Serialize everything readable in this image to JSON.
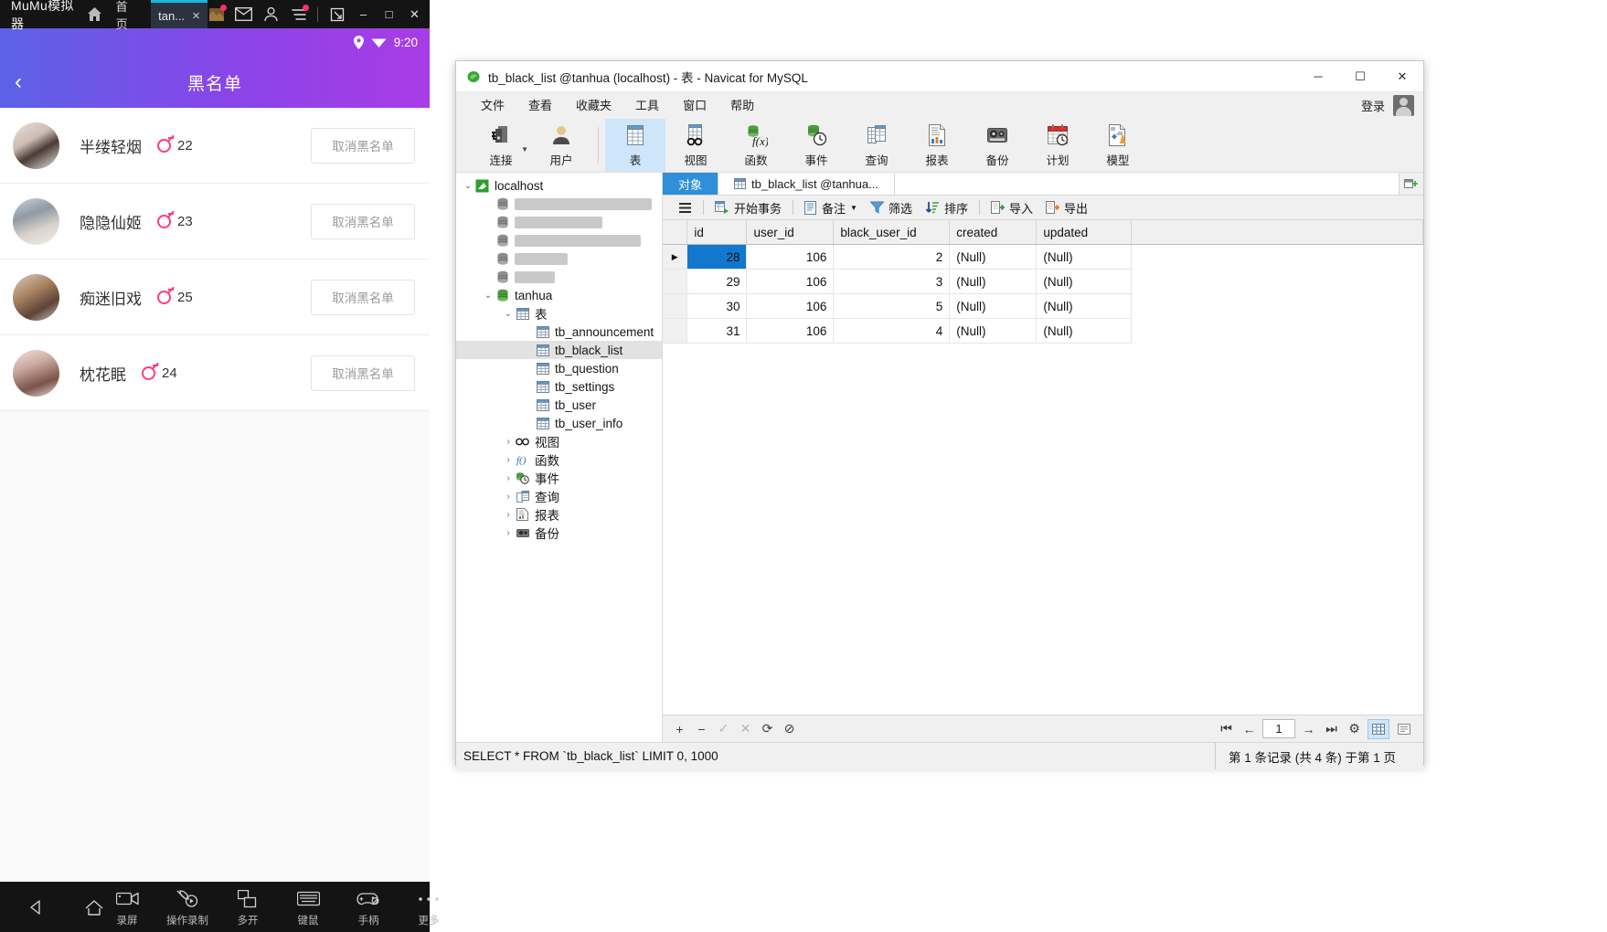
{
  "emulator": {
    "brand": "MuMu模拟器",
    "home_tab": "首页",
    "tab_label": "tan...",
    "tab_close": "×",
    "icons": {
      "home": "home-icon",
      "game": "game-thumb-icon",
      "mail": "mail-icon",
      "user": "user-icon",
      "menu": "menu-icon",
      "fullscreen": "fullscreen-icon",
      "minimize": "minimize-icon",
      "restore": "restore-icon",
      "close": "close-icon"
    },
    "window_minimize": "–",
    "window_restore": "□",
    "window_close": "✕",
    "status": {
      "location_icon": "location-pin-icon",
      "wifi_icon": "wifi-icon",
      "time": "9:20"
    },
    "app": {
      "back_icon": "back-chevron-icon",
      "title": "黑名单"
    },
    "list": [
      {
        "name": "半缕轻烟",
        "age": "22",
        "gender_icon": "male-gender-icon",
        "action": "取消黑名单"
      },
      {
        "name": "隐隐仙姬",
        "age": "23",
        "gender_icon": "male-gender-icon",
        "action": "取消黑名单"
      },
      {
        "name": "痴迷旧戏",
        "age": "25",
        "gender_icon": "male-gender-icon",
        "action": "取消黑名单"
      },
      {
        "name": "枕花眠",
        "age": "24",
        "gender_icon": "male-gender-icon",
        "action": "取消黑名单"
      }
    ],
    "navbar": {
      "back_icon": "triangle-back-icon",
      "home_icon": "home-outline-icon",
      "tools": [
        {
          "label": "录屏",
          "icon": "screen-record-icon"
        },
        {
          "label": "操作录制",
          "icon": "macro-record-icon"
        },
        {
          "label": "多开",
          "icon": "multi-instance-icon"
        },
        {
          "label": "键鼠",
          "icon": "keyboard-icon"
        },
        {
          "label": "手柄",
          "icon": "gamepad-icon"
        },
        {
          "label": "更多",
          "icon": "more-dots-icon"
        }
      ]
    }
  },
  "navicat": {
    "title": "tb_black_list @tanhua (localhost) - 表 - Navicat for MySQL",
    "title_icon": "navicat-logo-icon",
    "window_minimize": "─",
    "window_maximize": "☐",
    "window_close": "✕",
    "menu": [
      "文件",
      "查看",
      "收藏夹",
      "工具",
      "窗口",
      "帮助"
    ],
    "login_label": "登录",
    "toolbar": [
      {
        "label": "连接",
        "icon": "connection-icon",
        "has_caret": true,
        "selected": false
      },
      {
        "label": "用户",
        "icon": "user-icon",
        "has_caret": false,
        "selected": false
      },
      {
        "label": "表",
        "icon": "table-icon",
        "has_caret": false,
        "selected": true
      },
      {
        "label": "视图",
        "icon": "view-icon",
        "has_caret": false,
        "selected": false
      },
      {
        "label": "函数",
        "icon": "function-icon",
        "has_caret": false,
        "selected": false
      },
      {
        "label": "事件",
        "icon": "event-icon",
        "has_caret": false,
        "selected": false
      },
      {
        "label": "查询",
        "icon": "query-icon",
        "has_caret": false,
        "selected": false
      },
      {
        "label": "报表",
        "icon": "report-icon",
        "has_caret": false,
        "selected": false
      },
      {
        "label": "备份",
        "icon": "backup-icon",
        "has_caret": false,
        "selected": false
      },
      {
        "label": "计划",
        "icon": "schedule-icon",
        "has_caret": false,
        "selected": false
      },
      {
        "label": "模型",
        "icon": "model-icon",
        "has_caret": false,
        "selected": false
      }
    ],
    "tree": [
      {
        "label": "localhost",
        "indent": 0,
        "twisty": "⌄",
        "icon": "server-icon",
        "selected": false,
        "redacted": false
      },
      {
        "label": "",
        "indent": 1,
        "twisty": "",
        "icon": "database-icon",
        "selected": false,
        "redacted": true,
        "redact_w": 150
      },
      {
        "label": "",
        "indent": 1,
        "twisty": "",
        "icon": "database-icon",
        "selected": false,
        "redacted": true,
        "redact_w": 96
      },
      {
        "label": "",
        "indent": 1,
        "twisty": "",
        "icon": "database-icon",
        "selected": false,
        "redacted": true,
        "redact_w": 138
      },
      {
        "label": "",
        "indent": 1,
        "twisty": "",
        "icon": "database-icon",
        "selected": false,
        "redacted": true,
        "redact_w": 58
      },
      {
        "label": "",
        "indent": 1,
        "twisty": "",
        "icon": "database-icon",
        "selected": false,
        "redacted": true,
        "redact_w": 44
      },
      {
        "label": "tanhua",
        "indent": 1,
        "twisty": "⌄",
        "icon": "database-open-icon",
        "selected": false,
        "redacted": false
      },
      {
        "label": "表",
        "indent": 2,
        "twisty": "⌄",
        "icon": "table-icon",
        "selected": false,
        "redacted": false
      },
      {
        "label": "tb_announcement",
        "indent": 3,
        "twisty": "",
        "icon": "table-icon",
        "selected": false,
        "redacted": false
      },
      {
        "label": "tb_black_list",
        "indent": 3,
        "twisty": "",
        "icon": "table-icon",
        "selected": true,
        "redacted": false
      },
      {
        "label": "tb_question",
        "indent": 3,
        "twisty": "",
        "icon": "table-icon",
        "selected": false,
        "redacted": false
      },
      {
        "label": "tb_settings",
        "indent": 3,
        "twisty": "",
        "icon": "table-icon",
        "selected": false,
        "redacted": false
      },
      {
        "label": "tb_user",
        "indent": 3,
        "twisty": "",
        "icon": "table-icon",
        "selected": false,
        "redacted": false
      },
      {
        "label": "tb_user_info",
        "indent": 3,
        "twisty": "",
        "icon": "table-icon",
        "selected": false,
        "redacted": false
      },
      {
        "label": "视图",
        "indent": 2,
        "twisty": "›",
        "icon": "view-icon",
        "selected": false,
        "redacted": false
      },
      {
        "label": "函数",
        "indent": 2,
        "twisty": "›",
        "icon": "function-icon",
        "selected": false,
        "redacted": false
      },
      {
        "label": "事件",
        "indent": 2,
        "twisty": "›",
        "icon": "event-icon",
        "selected": false,
        "redacted": false
      },
      {
        "label": "查询",
        "indent": 2,
        "twisty": "›",
        "icon": "query-icon",
        "selected": false,
        "redacted": false
      },
      {
        "label": "报表",
        "indent": 2,
        "twisty": "›",
        "icon": "report-icon",
        "selected": false,
        "redacted": false
      },
      {
        "label": "备份",
        "indent": 2,
        "twisty": "›",
        "icon": "backup-icon",
        "selected": false,
        "redacted": false
      }
    ],
    "tabs": [
      {
        "label": "对象",
        "active": true,
        "icon": ""
      },
      {
        "label": "tb_black_list @tanhua...",
        "active": false,
        "icon": "table-icon"
      }
    ],
    "tab_add_icon": "add-tab-icon",
    "grid_toolbar": [
      {
        "label": "",
        "icon": "hamburger-icon",
        "caret": false
      },
      {
        "label": "开始事务",
        "icon": "begin-transaction-icon",
        "caret": false
      },
      {
        "label": "备注",
        "icon": "note-icon",
        "caret": true
      },
      {
        "label": "筛选",
        "icon": "filter-icon",
        "caret": false
      },
      {
        "label": "排序",
        "icon": "sort-icon",
        "caret": false
      },
      {
        "label": "导入",
        "icon": "import-icon",
        "caret": false
      },
      {
        "label": "导出",
        "icon": "export-icon",
        "caret": false
      }
    ],
    "grid": {
      "columns": [
        "id",
        "user_id",
        "black_user_id",
        "created",
        "updated"
      ],
      "rows": [
        {
          "marker": "▶",
          "cells": [
            "28",
            "106",
            "2",
            "(Null)",
            "(Null)"
          ],
          "selected_col": 0
        },
        {
          "marker": "",
          "cells": [
            "29",
            "106",
            "3",
            "(Null)",
            "(Null)"
          ],
          "selected_col": -1
        },
        {
          "marker": "",
          "cells": [
            "30",
            "106",
            "5",
            "(Null)",
            "(Null)"
          ],
          "selected_col": -1
        },
        {
          "marker": "",
          "cells": [
            "31",
            "106",
            "4",
            "(Null)",
            "(Null)"
          ],
          "selected_col": -1
        }
      ]
    },
    "grid_footer": {
      "add_icon": "+",
      "remove_icon": "−",
      "confirm_icon": "✓",
      "cancel_icon": "✕",
      "refresh_icon": "⟳",
      "stop_icon": "⊘",
      "first_icon": "⏮",
      "prev_icon": "←",
      "page_value": "1",
      "next_icon": "→",
      "last_icon": "⏭",
      "append_icon": "▸+",
      "settings_icon": "⚙",
      "grid_view_icon": "grid-view-icon",
      "form_view_icon": "form-view-icon"
    },
    "statusbar": {
      "sql": "SELECT * FROM `tb_black_list` LIMIT 0, 1000",
      "record_info": "第 1 条记录 (共 4 条) 于第 1 页"
    }
  }
}
